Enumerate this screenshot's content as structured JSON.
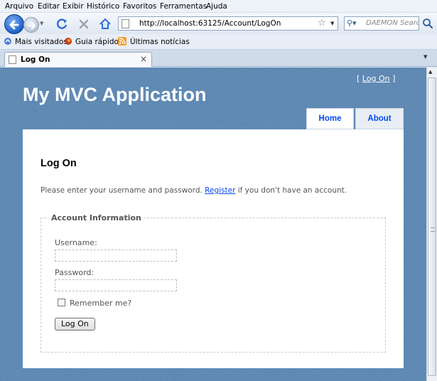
{
  "browser": {
    "menu": [
      "Arquivo",
      "Editar",
      "Exibir",
      "Histórico",
      "Favoritos",
      "Ferramentas",
      "Ajuda"
    ],
    "url": "http://localhost:63125/Account/LogOn",
    "search_placeholder": "DAEMON Search",
    "bookmarks": [
      "Mais visitados",
      "Guia rápido",
      "Últimas notícias"
    ],
    "tab_title": "Log On",
    "tab_close": "×"
  },
  "site": {
    "login_prefix": "[ ",
    "login_link": "Log On",
    "login_suffix": " ]",
    "title": "My MVC Application",
    "menu": [
      "Home",
      "About"
    ],
    "menu_color": "#034af3",
    "background_color": "#5c87b2"
  },
  "page": {
    "heading": "Log On",
    "intro_before": "Please enter your username and password. ",
    "intro_link": "Register",
    "intro_after": " if you don't have an account.",
    "legend": "Account Information",
    "username_label": "Username:",
    "username_value": "",
    "password_label": "Password:",
    "password_value": "",
    "remember_label": "Remember me?",
    "submit_label": "Log On"
  }
}
